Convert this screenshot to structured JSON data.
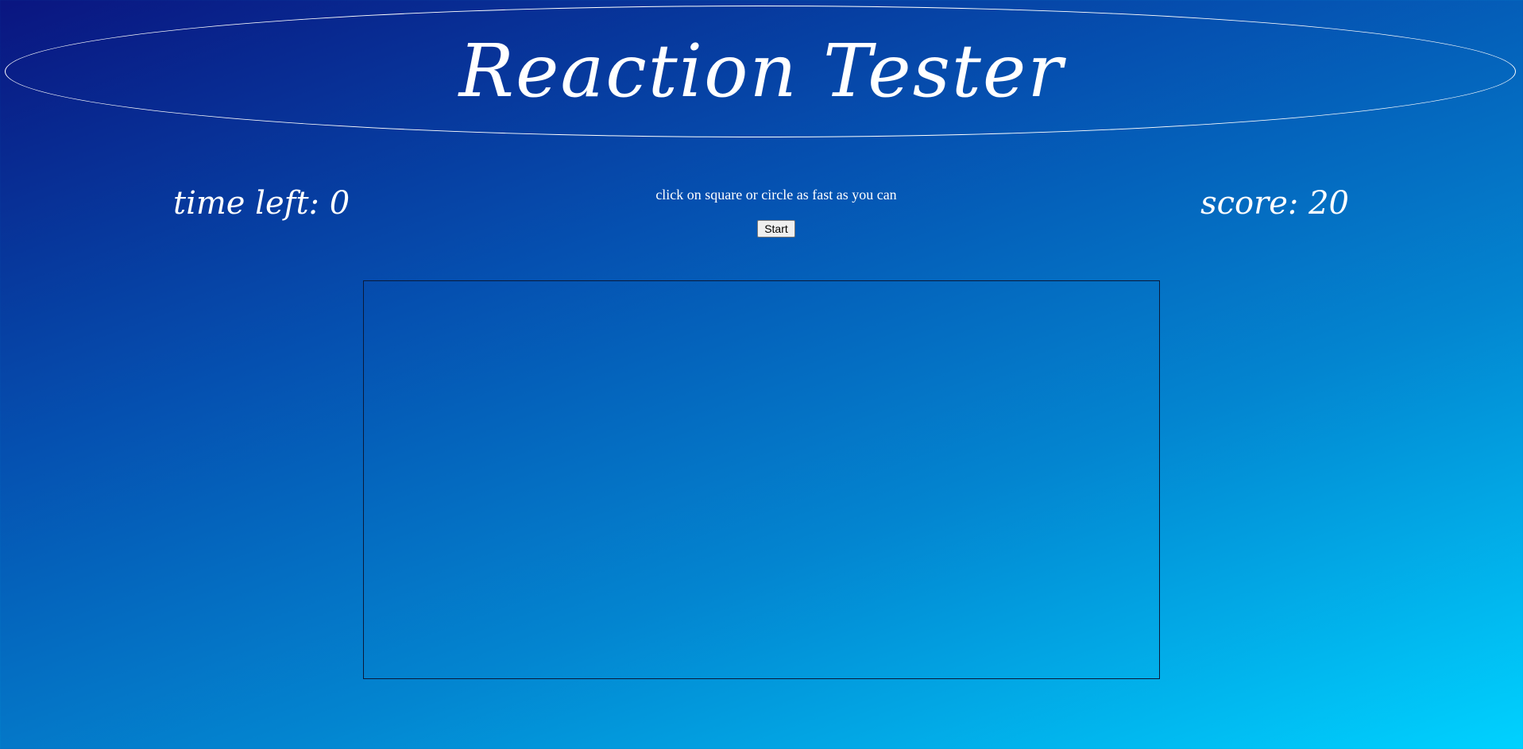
{
  "header": {
    "title": "Reaction Tester"
  },
  "status": {
    "time_left_label": "time left: 0",
    "score_label": "score: 20",
    "instructions": "click on square or circle as fast as you can"
  },
  "controls": {
    "start_label": "Start"
  },
  "colors": {
    "gradient_start": "#0a1580",
    "gradient_end": "#00d2ff",
    "text": "#ffffff"
  }
}
